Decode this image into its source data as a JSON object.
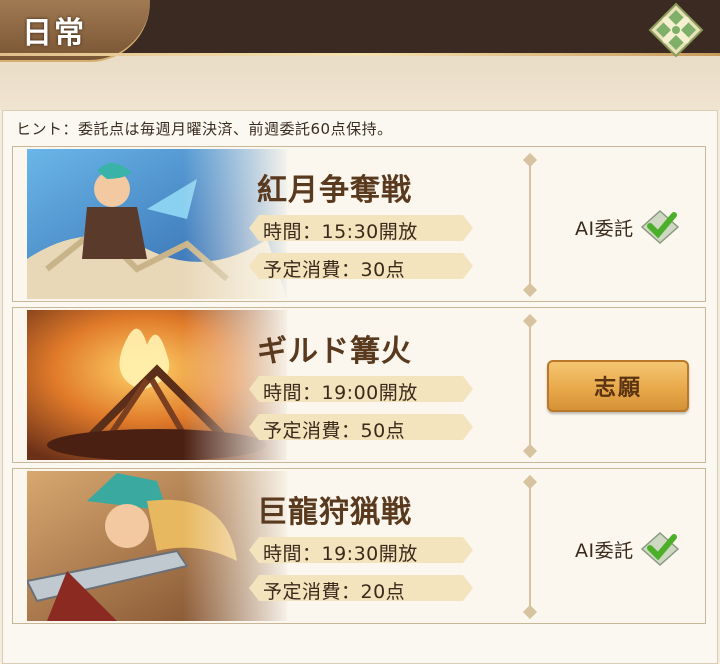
{
  "header": {
    "title": "日常"
  },
  "hint": "ヒント：委託点は毎週月曜決済、前週委託60点保持。",
  "events": [
    {
      "name": "紅月争奪戦",
      "time": "時間：15:30開放",
      "cost": "予定消費：30点",
      "action_type": "ai",
      "action_label": "AI委託",
      "checked": true
    },
    {
      "name": "ギルド篝火",
      "time": "時間：19:00開放",
      "cost": "予定消費：50点",
      "action_type": "button",
      "action_label": "志願"
    },
    {
      "name": "巨龍狩猟戦",
      "time": "時間：19:30開放",
      "cost": "予定消費：20点",
      "action_type": "ai",
      "action_label": "AI委託",
      "checked": true
    }
  ],
  "icons": {
    "close": "close-icon",
    "check": "check-icon"
  },
  "colors": {
    "accent_gold": "#e8a94b",
    "title_brown": "#5a3a1e",
    "check_green": "#4caf2a"
  }
}
